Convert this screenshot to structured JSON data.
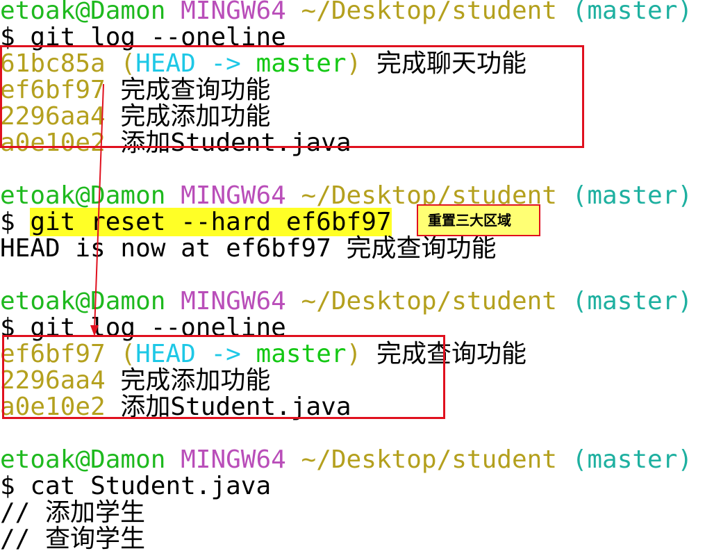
{
  "colors": {
    "user": "#1eb91e",
    "mingw": "#b94eb9",
    "path": "#b4a01e",
    "branch": "#1eb0a0",
    "hash": "#b4a01e",
    "head": "#1ec8e6",
    "master": "#14c814",
    "annotation_box": "#e0101e",
    "highlight": "#ffff26",
    "note_bg": "#ffff74"
  },
  "prompt": {
    "user_host": "etoak@Damon",
    "env": "MINGW64",
    "path": "~/Desktop/student",
    "branch": "(master)",
    "symbol": "$"
  },
  "blocks": [
    {
      "command": "git log --oneline",
      "commits": [
        {
          "hash": "61bc85a",
          "open": "(",
          "head": "HEAD",
          "arrow": "->",
          "branch": "master",
          "close": ")",
          "message": "完成聊天功能"
        },
        {
          "hash": "ef6bf97",
          "message": "完成查询功能"
        },
        {
          "hash": "2296aa4",
          "message": "完成添加功能"
        },
        {
          "hash": "a0e10e2",
          "message_cjk": "添加",
          "message_rest": "Student.java"
        }
      ]
    },
    {
      "command": "git reset --hard ef6bf97",
      "output_text": "HEAD is now at ef6bf97",
      "output_message": "完成查询功能",
      "note": "重置三大区域"
    },
    {
      "command": "git log --oneline",
      "commits": [
        {
          "hash": "ef6bf97",
          "open": "(",
          "head": "HEAD",
          "arrow": "->",
          "branch": "master",
          "close": ")",
          "message": "完成查询功能"
        },
        {
          "hash": "2296aa4",
          "message": "完成添加功能"
        },
        {
          "hash": "a0e10e2",
          "message_cjk": "添加",
          "message_rest": "Student.java"
        }
      ]
    },
    {
      "command": "cat Student.java",
      "output": [
        {
          "prefix": "//",
          "text": "添加学生"
        },
        {
          "prefix": "//",
          "text": "查询学生"
        }
      ]
    }
  ]
}
